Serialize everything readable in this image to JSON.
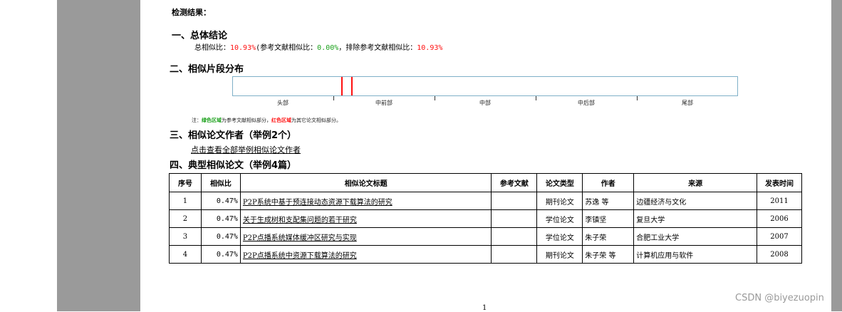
{
  "result_label": "检测结果：",
  "section1": {
    "heading": "一、总体结论",
    "total_prefix": "总相似比：",
    "total_value": "10.93%",
    "ref_prefix": "(参考文献相似比：",
    "ref_value": "0.00%",
    "excl_prefix": "，排除参考文献相似比：",
    "excl_value": "10.93%"
  },
  "section2": {
    "heading": "二、相似片段分布",
    "segments": [
      "头部",
      "中前部",
      "中部",
      "中后部",
      "尾部"
    ],
    "note_prefix": "注：",
    "note_green": "绿色区域",
    "note_mid": "为参考文献相似部分，",
    "note_red": "红色区域",
    "note_suffix": "为其它论文相似部分。"
  },
  "section3": {
    "heading": "三、相似论文作者（举例2个）",
    "link": "点击查看全部举例相似论文作者"
  },
  "section4": {
    "heading": "四、典型相似论文（举例4篇）",
    "headers": [
      "序号",
      "相似比",
      "相似论文标题",
      "参考文献",
      "论文类型",
      "作者",
      "来源",
      "发表时间"
    ],
    "rows": [
      {
        "no": "1",
        "ratio": "0.47%",
        "title": "P2P系统中基于预连接动态资源下载算法的研究",
        "ref": "",
        "type": "期刊论文",
        "author": "苏逸 等",
        "source": "边疆经济与文化",
        "year": "2011"
      },
      {
        "no": "2",
        "ratio": "0.47%",
        "title": "关于生成树和支配集问题的若干研究",
        "ref": "",
        "type": "学位论文",
        "author": "李镇坚",
        "source": "复旦大学",
        "year": "2006"
      },
      {
        "no": "3",
        "ratio": "0.47%",
        "title": "P2P点播系统媒体缓冲区研究与实现",
        "ref": "",
        "type": "学位论文",
        "author": "朱子荣",
        "source": "合肥工业大学",
        "year": "2007"
      },
      {
        "no": "4",
        "ratio": "0.47%",
        "title": "P2P点播系统中资源下载算法的研究",
        "ref": "",
        "type": "期刊论文",
        "author": "朱子荣 等",
        "source": "计算机应用与软件",
        "year": "2008"
      }
    ]
  },
  "page_number": "1",
  "watermark": "CSDN @biyezuopin",
  "colors": {
    "red": "#ff1010",
    "green": "#1aa01a",
    "gutter": "#9a9a9a"
  }
}
